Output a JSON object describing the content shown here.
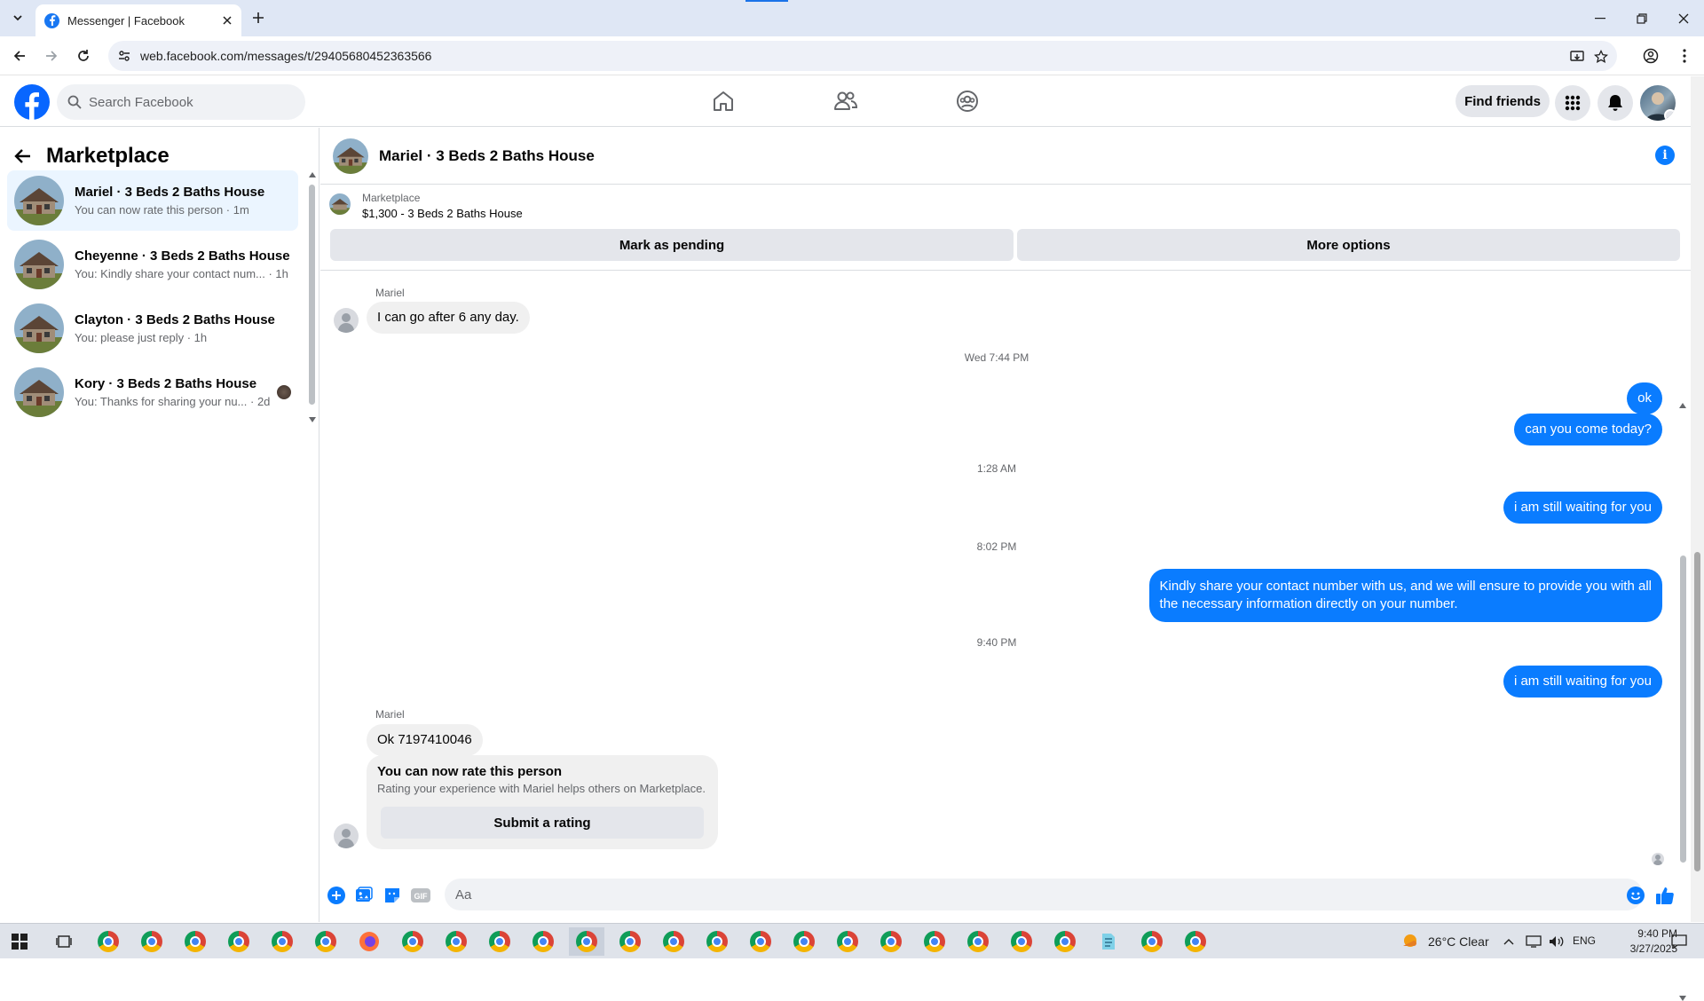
{
  "browser": {
    "tab_title": "Messenger | Facebook",
    "url": "web.facebook.com/messages/t/29405680452363566"
  },
  "header": {
    "search_placeholder": "Search Facebook",
    "find_friends_label": "Find friends"
  },
  "sidebar": {
    "title": "Marketplace",
    "conversations": [
      {
        "name": "Mariel · 3 Beds 2 Baths House",
        "snippet": "You can now rate this person · 1m"
      },
      {
        "name": "Cheyenne · 3 Beds 2 Baths House",
        "snippet": "You: Kindly share your contact num... · 1h"
      },
      {
        "name": "Clayton · 3 Beds 2 Baths House",
        "snippet": "You: please just reply · 1h"
      },
      {
        "name": "Kory · 3 Beds 2 Baths House",
        "snippet": "You: Thanks for sharing your nu... · 2d"
      }
    ]
  },
  "chat": {
    "title": "Mariel · 3 Beds 2 Baths House",
    "listing_label": "Marketplace",
    "listing_price": "$1,300 - 3 Beds 2 Baths House",
    "mark_pending_label": "Mark as pending",
    "more_options_label": "More options",
    "messages": {
      "sender1": "Mariel",
      "in1": "I can go after 6 any day.",
      "ts1": "Wed 7:44 PM",
      "out1": "ok",
      "out2": "can you come today?",
      "ts2": "1:28 AM",
      "out3": "i am still waiting for you",
      "ts3": "8:02 PM",
      "out4_line1": "Kindly share your contact number with us, and we will ensure to provide you with all",
      "out4_line2": "the necessary information directly on your number.",
      "ts4": "9:40 PM",
      "out5": "i am still waiting for you",
      "sender2": "Mariel",
      "in2": "Ok 7197410046"
    },
    "rating": {
      "title": "You can now rate this person",
      "desc": "Rating your experience with Mariel helps others on Marketplace.",
      "button": "Submit a rating"
    },
    "composer_placeholder": "Aa"
  },
  "taskbar": {
    "weather": "26°C  Clear",
    "lang": "ENG",
    "time": "9:40 PM",
    "date": "3/27/2025"
  },
  "colors": {
    "brand_blue": "#0866ff",
    "messenger_blue": "#0a7cff",
    "active_row": "#ebf5ff"
  }
}
